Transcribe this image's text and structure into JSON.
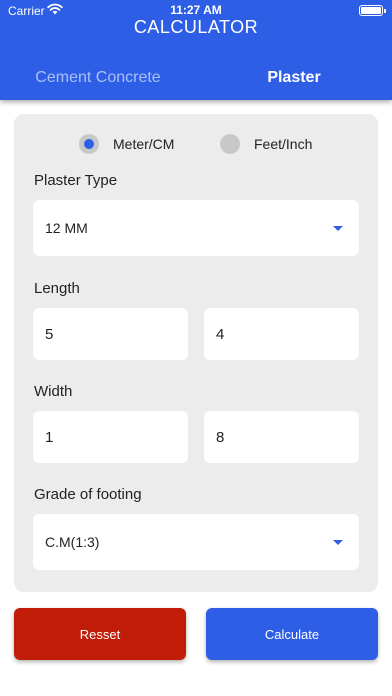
{
  "status_bar": {
    "carrier": "Carrier",
    "time": "11:27 AM",
    "wifi_icon": "wifi-icon",
    "battery_icon": "battery-icon"
  },
  "header": {
    "title": "CALCULATOR"
  },
  "tabs": [
    {
      "label": "Cement Concrete",
      "active": false
    },
    {
      "label": "Plaster",
      "active": true
    }
  ],
  "units": {
    "options": [
      {
        "label": "Meter/CM",
        "selected": true
      },
      {
        "label": "Feet/Inch",
        "selected": false
      }
    ]
  },
  "plaster_type": {
    "label": "Plaster Type",
    "value": "12 MM"
  },
  "length": {
    "label": "Length",
    "first": "5",
    "second": "4"
  },
  "width": {
    "label": "Width",
    "first": "1",
    "second": "8"
  },
  "grade": {
    "label": "Grade of footing",
    "value": "C.M(1:3)"
  },
  "buttons": {
    "reset": "Resset",
    "calculate": "Calculate"
  },
  "colors": {
    "primary": "#2f5ee6",
    "reset": "#c01c08",
    "card": "#ececec"
  }
}
